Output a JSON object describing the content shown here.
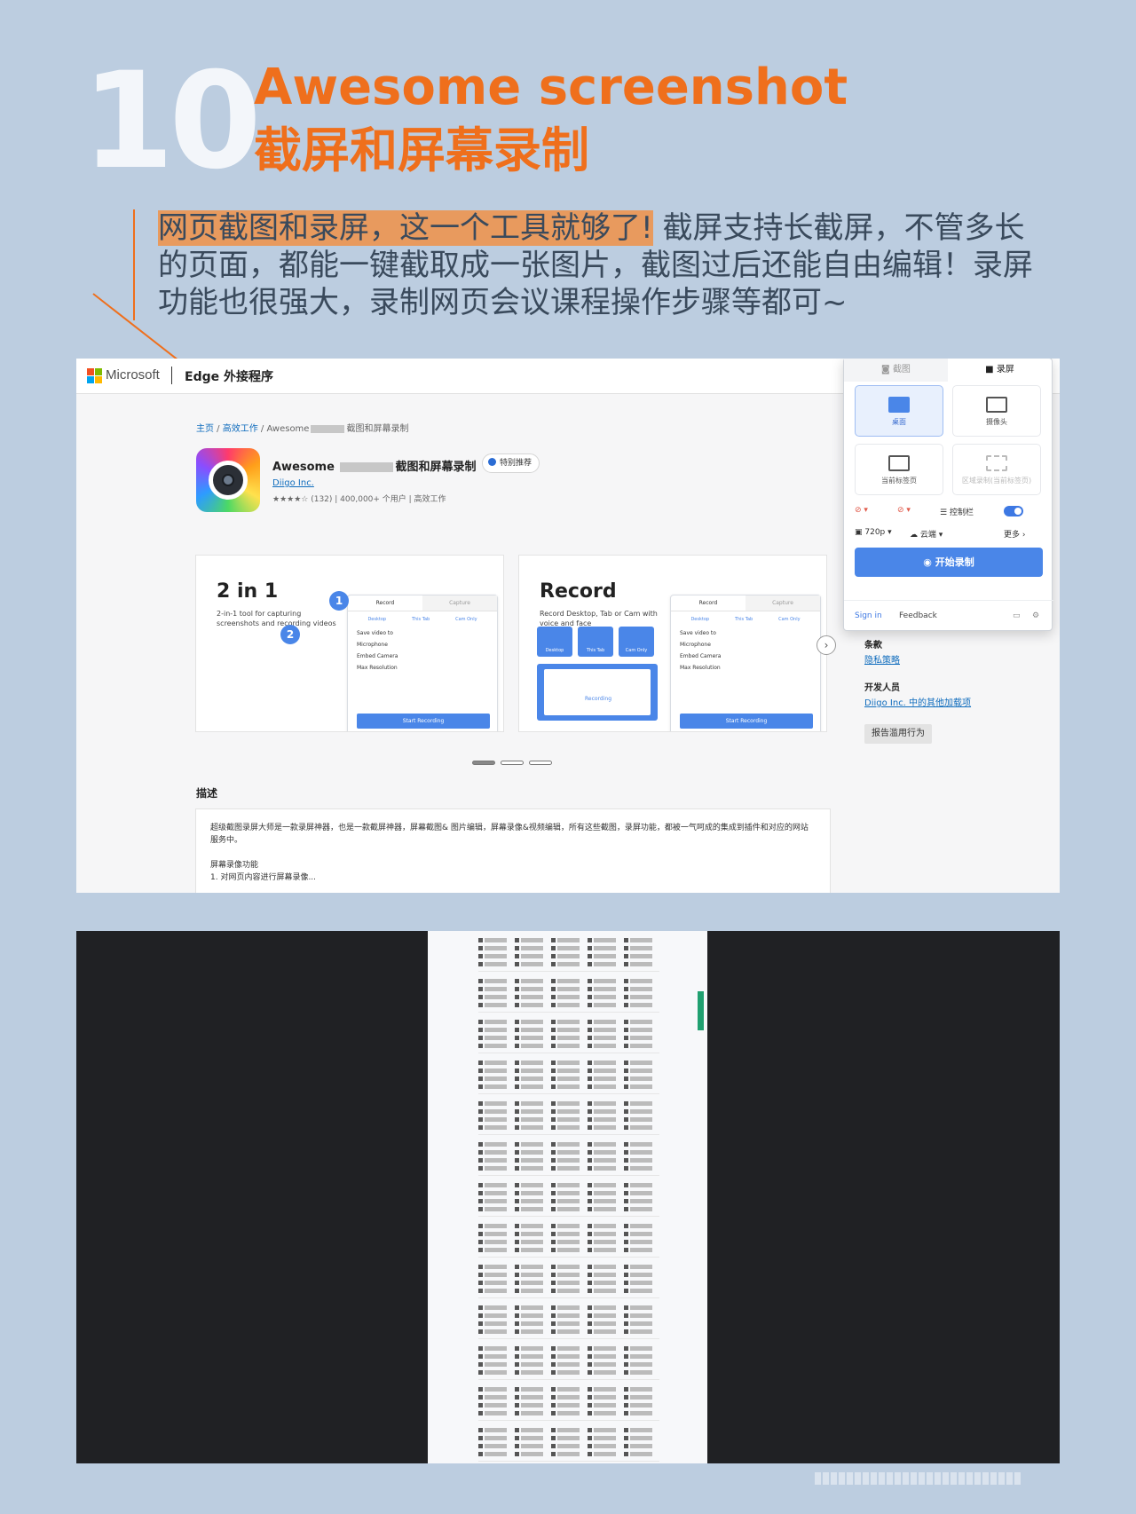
{
  "header": {
    "number": "10",
    "title_en": "Awesome screenshot",
    "title_cn": "截屏和屏幕录制",
    "highlight": "网页截图和录屏，这一个工具就够了!",
    "body": " 截屏支持长截屏，不管多长的页面，都能一键截取成一张图片，截图过后还能自由编辑！录屏功能也很强大，录制网页会议课程操作步骤等都可~"
  },
  "store": {
    "brand": "Microsoft",
    "section": "Edge 外接程序",
    "breadcrumb": {
      "home": "主页",
      "category": "高效工作",
      "prefix": " / Awesome",
      "suffix": "截图和屏幕录制"
    },
    "app_name_prefix": "Awesome",
    "app_name_suffix": "截图和屏幕录制",
    "featured_badge": "特别推荐",
    "developer": "Diigo Inc.",
    "rating_stars": "★★★★☆",
    "meta": "(132)  |  400,000+ 个用户  |  高效工作",
    "colors": {
      "ms_red": "#f25022",
      "ms_green": "#7fba00",
      "ms_blue": "#00a4ef",
      "ms_yellow": "#ffb900",
      "link": "#0f6cbd",
      "accent": "#4a86e8"
    },
    "cards": [
      {
        "title": "2 in 1",
        "subtitle": "2-in-1 tool for capturing screenshots and recording videos",
        "tab_a": "Record",
        "tab_b": "Capture",
        "icons": [
          "Desktop",
          "This Tab",
          "Cam Only"
        ],
        "rows": [
          "Save video to",
          "Microphone",
          "Embed Camera",
          "Max Resolution"
        ],
        "button": "Start Recording",
        "bubble1": "1",
        "bubble2": "2"
      },
      {
        "title": "Record",
        "subtitle": "Record Desktop, Tab or Cam with voice and face",
        "tab_a": "Record",
        "tab_b": "Capture",
        "tiles": [
          "Desktop",
          "This Tab",
          "Cam Only"
        ],
        "screen_label": "Recording",
        "rows": [
          "Save video to",
          "Microphone",
          "Embed Camera",
          "Max Resolution"
        ],
        "button": "Start Recording"
      }
    ],
    "description_heading": "描述",
    "description_p1": "超级截图录屏大师是一款录屏神器，也是一款截屏神器，屏幕截图& 图片编辑，屏幕录像&视频编辑，所有这些截图，录屏功能，都被一气呵成的集成到插件和对应的网站服务中。",
    "description_p2": "屏幕录像功能",
    "description_p3": "1. 对网页内容进行屏幕录像...",
    "side_terms": "条款",
    "side_privacy": "隐私策略",
    "side_dev": "开发人员",
    "side_more": "Diigo Inc. 中的其他加载项",
    "report": "报告滥用行为"
  },
  "popup": {
    "tab_capture": "截图",
    "tab_record": "录屏",
    "modes": [
      {
        "label": "桌面",
        "selected": true
      },
      {
        "label": "摄像头",
        "selected": false
      },
      {
        "label": "当前标签页",
        "selected": false
      },
      {
        "label": "区域录制(当前标签页)",
        "selected": false,
        "disabled": true
      }
    ],
    "controls_label": "控制栏",
    "controls_on": true,
    "resolution": "720p",
    "storage": "云端",
    "more": "更多 ›",
    "start": "开始录制",
    "sign_in": "Sign in",
    "feedback": "Feedback"
  }
}
